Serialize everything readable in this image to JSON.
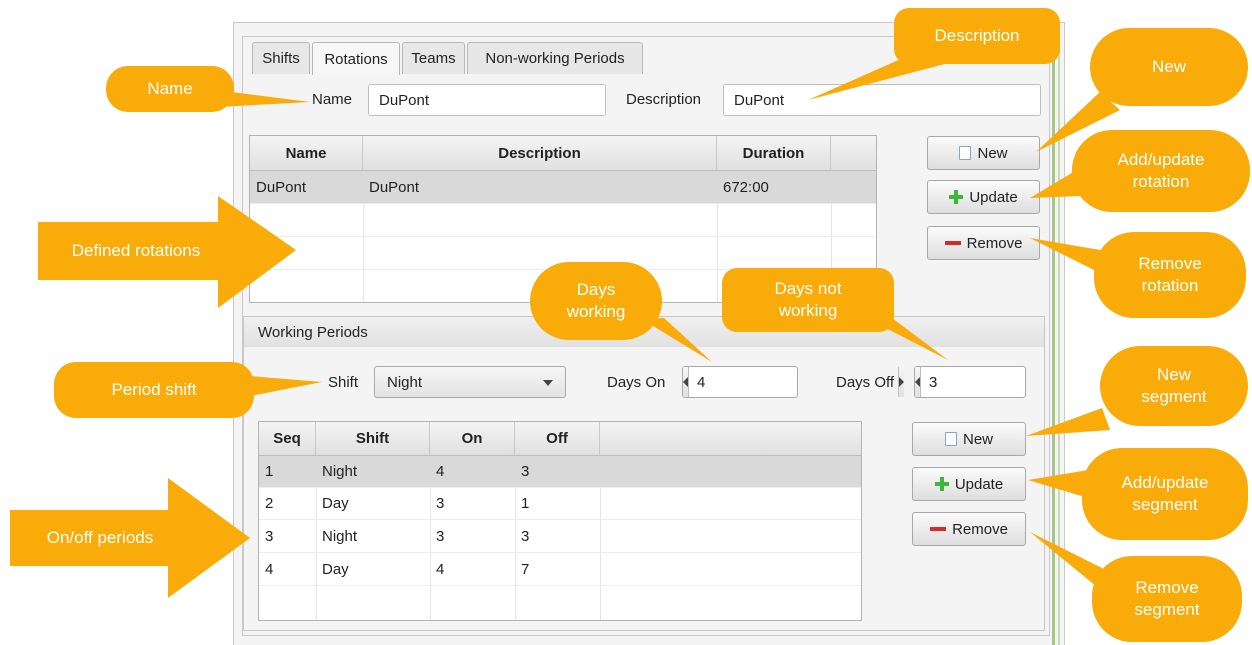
{
  "tabs": [
    {
      "label": "Shifts",
      "active": false
    },
    {
      "label": "Rotations",
      "active": true
    },
    {
      "label": "Teams",
      "active": false
    },
    {
      "label": "Non-working Periods",
      "active": false
    }
  ],
  "rotation_form": {
    "name_label": "Name",
    "name_value": "DuPont",
    "description_label": "Description",
    "description_value": "DuPont"
  },
  "rotations_table": {
    "columns": [
      "Name",
      "Description",
      "Duration"
    ],
    "rows": [
      {
        "name": "DuPont",
        "description": "DuPont",
        "duration": "672:00",
        "selected": true
      }
    ]
  },
  "rotation_buttons": {
    "new": "New",
    "update": "Update",
    "remove": "Remove"
  },
  "working_periods": {
    "header": "Working Periods",
    "shift_label": "Shift",
    "shift_value": "Night",
    "days_on_label": "Days On",
    "days_on_value": "4",
    "days_off_label": "Days Off",
    "days_off_value": "3"
  },
  "segments_table": {
    "columns": [
      "Seq",
      "Shift",
      "On",
      "Off"
    ],
    "rows": [
      {
        "seq": "1",
        "shift": "Night",
        "on": "4",
        "off": "3",
        "selected": true
      },
      {
        "seq": "2",
        "shift": "Day",
        "on": "3",
        "off": "1",
        "selected": false
      },
      {
        "seq": "3",
        "shift": "Night",
        "on": "3",
        "off": "3",
        "selected": false
      },
      {
        "seq": "4",
        "shift": "Day",
        "on": "4",
        "off": "7",
        "selected": false
      }
    ]
  },
  "segment_buttons": {
    "new": "New",
    "update": "Update",
    "remove": "Remove"
  },
  "callouts": {
    "name": "Name",
    "description": "Description",
    "new": "New",
    "add_update_rotation": "Add/update\nrotation",
    "defined_rotations": "Defined rotations",
    "remove_rotation": "Remove\nrotation",
    "days_working": "Days\nworking",
    "days_not_working": "Days not\nworking",
    "period_shift": "Period shift",
    "new_segment": "New\nsegment",
    "add_update_segment": "Add/update\nsegment",
    "on_off_periods": "On/off periods",
    "remove_segment": "Remove\nsegment"
  },
  "colors": {
    "callout": "#f9ab0a",
    "selected_row": "#d9d9d9",
    "plus_icon": "#3bb83b",
    "minus_icon": "#d22d2d"
  },
  "icons": {
    "new": "document-icon",
    "update": "plus-icon",
    "remove": "minus-icon",
    "combo": "chevron-down-icon",
    "spinner_decrement": "triangle-left-icon",
    "spinner_increment": "triangle-right-icon"
  }
}
